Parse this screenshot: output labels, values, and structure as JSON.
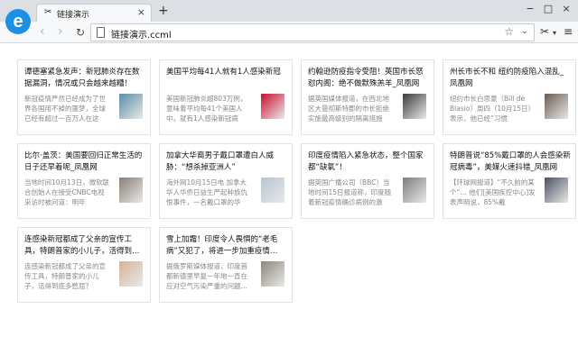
{
  "browser": {
    "logo_letter": "e",
    "tab_icon": "scissors-icon",
    "tab_title": "链接演示",
    "tab_close": "×",
    "new_tab": "+",
    "url": "链接演示.ccml",
    "window_controls": [
      "−",
      "□",
      "×"
    ]
  },
  "cards": [
    {
      "title": "谭德塞紧急发声：新冠肺炎存在数据漏洞，情况或只会越来越糟！",
      "summary": "新冠疫情严然已经成为了世界各国用不掉的噩梦，全球已经有超过一百万人在这",
      "thumb": "virus-image",
      "thumb_color": "#5a8ea6"
    },
    {
      "title": "美国平均每41人就有1人感染新冠",
      "summary": "美国新冠肺炎超803万例，意味着平均每41个美国人中，就有1人感染新冠病",
      "thumb": "newspaper-logo-image",
      "thumb_color": "#c8102e"
    },
    {
      "title": "约翰逊防疫指令受阻！英国市长怒怼内阁：绝不做默殊羔羊_凤凰网",
      "summary": "据英国媒体报道，在西北地区大曼彻斯特郡的市长拒绝实施最高级别的隔离措施",
      "thumb": "officials-image",
      "thumb_color": "#3c3c3c"
    },
    {
      "title": "州长市长不和 纽约防疫陷入混乱_凤凰网",
      "summary": "纽约市长白思豪（Bill de Blasio）周四（10月15日）表示，他已经“习惯",
      "thumb": "governor-image",
      "thumb_color": "#6b5a4e"
    },
    {
      "title": "比尔·盖茨：美国要回归正常生活的日子还早着呢_凤凰网",
      "summary": "当地时间10月13日，微软联合创始人在接受CNBC电视采访时被问道：明年",
      "thumb": "bill-gates-image",
      "thumb_color": "#8a7f74"
    },
    {
      "title": "加拿大华裔男子戴口罩遭白人威胁：“想杀掉亚洲人”",
      "summary": "海外网10月15日电 加拿大华人华侨日益生严起种族仇恨事件，一名戴口罩的华",
      "thumb": "man-mask-image",
      "thumb_color": "#b7c4d2"
    },
    {
      "title": "印度疫情陷入紧急状态，整个国家都“缺氧”！",
      "summary": "据英国广播公司（BBC）当地时间15日报道称，印度随着新冠疫情确诊病例的激",
      "thumb": "oxygen-tanks-image",
      "thumb_color": "#7d7d7d"
    },
    {
      "title": "特朗普说“85%戴口罩的人会感染新冠病毒”，美媒火速抖错_凤凰网",
      "summary": "【环球网报道】“不久前的某个“… 他们[美国疾控中心]发表声明说，85%戴",
      "thumb": "trump-image",
      "thumb_color": "#4a4f64"
    },
    {
      "title": "连感染新冠都成了父亲的宣传工具，特朗普家的小儿子，活得到…",
      "summary": "连感染新冠都成了父亲的宣传工具，特朗普家的小儿子，活得到底多憋屈？",
      "thumb": "boy-image",
      "thumb_color": "#d2b39a"
    },
    {
      "title": "雪上加霜！印度令人畏惧的“老毛病”又犯了，将进一步加重疫情…",
      "summary": "据俄罗斯媒体报道，印度首都新德里早复一年地一直在应对空气污染严重的问题…",
      "thumb": "smog-image",
      "thumb_color": "#8d8678"
    }
  ]
}
